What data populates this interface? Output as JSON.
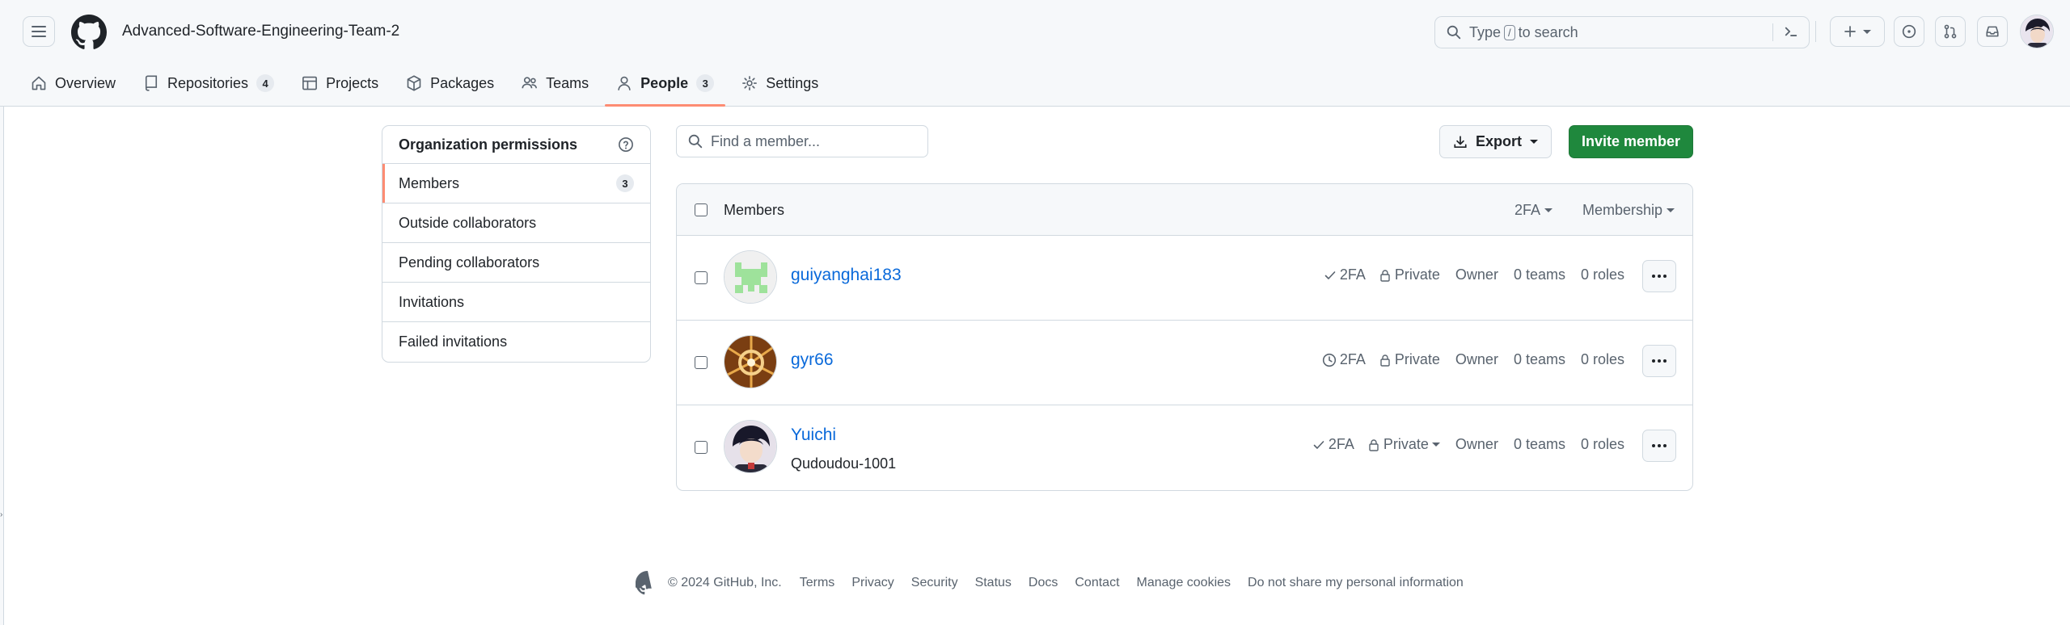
{
  "header": {
    "org_name": "Advanced-Software-Engineering-Team-2",
    "search_prefix": "Type",
    "search_key": "/",
    "search_suffix": "to search"
  },
  "nav": {
    "tabs": [
      {
        "label": "Overview",
        "icon": "home-icon"
      },
      {
        "label": "Repositories",
        "icon": "repo-icon",
        "count": "4"
      },
      {
        "label": "Projects",
        "icon": "table-icon"
      },
      {
        "label": "Packages",
        "icon": "package-icon"
      },
      {
        "label": "Teams",
        "icon": "people-icon"
      },
      {
        "label": "People",
        "icon": "person-icon",
        "count": "3",
        "active": true
      },
      {
        "label": "Settings",
        "icon": "gear-icon"
      }
    ]
  },
  "sidebar": {
    "heading": "Organization permissions",
    "items": [
      {
        "label": "Members",
        "count": "3",
        "selected": true
      },
      {
        "label": "Outside collaborators"
      },
      {
        "label": "Pending collaborators"
      },
      {
        "label": "Invitations"
      },
      {
        "label": "Failed invitations"
      }
    ]
  },
  "toolbar": {
    "find_placeholder": "Find a member...",
    "export_label": "Export",
    "invite_label": "Invite member"
  },
  "table": {
    "header_members": "Members",
    "header_2fa": "2FA",
    "header_membership": "Membership",
    "members": [
      {
        "username": "guiyanghai183",
        "full_name": "",
        "twofa": "2FA",
        "twofa_icon": "check-icon",
        "visibility": "Private",
        "role": "Owner",
        "teams": "0 teams",
        "roles": "0 roles"
      },
      {
        "username": "gyr66",
        "full_name": "",
        "twofa": "2FA",
        "twofa_icon": "clock-icon",
        "visibility": "Private",
        "role": "Owner",
        "teams": "0 teams",
        "roles": "0 roles"
      },
      {
        "username": "Yuichi",
        "full_name": "Qudoudou-1001",
        "twofa": "2FA",
        "twofa_icon": "check-icon",
        "visibility": "Private",
        "role": "Owner",
        "teams": "0 teams",
        "roles": "0 roles"
      }
    ]
  },
  "footer": {
    "copyright": "© 2024 GitHub, Inc.",
    "links": [
      "Terms",
      "Privacy",
      "Security",
      "Status",
      "Docs",
      "Contact",
      "Manage cookies",
      "Do not share my personal information"
    ]
  },
  "colors": {
    "accent_underline": "#fd8c73",
    "primary_button": "#1f883d",
    "link": "#0969da"
  }
}
